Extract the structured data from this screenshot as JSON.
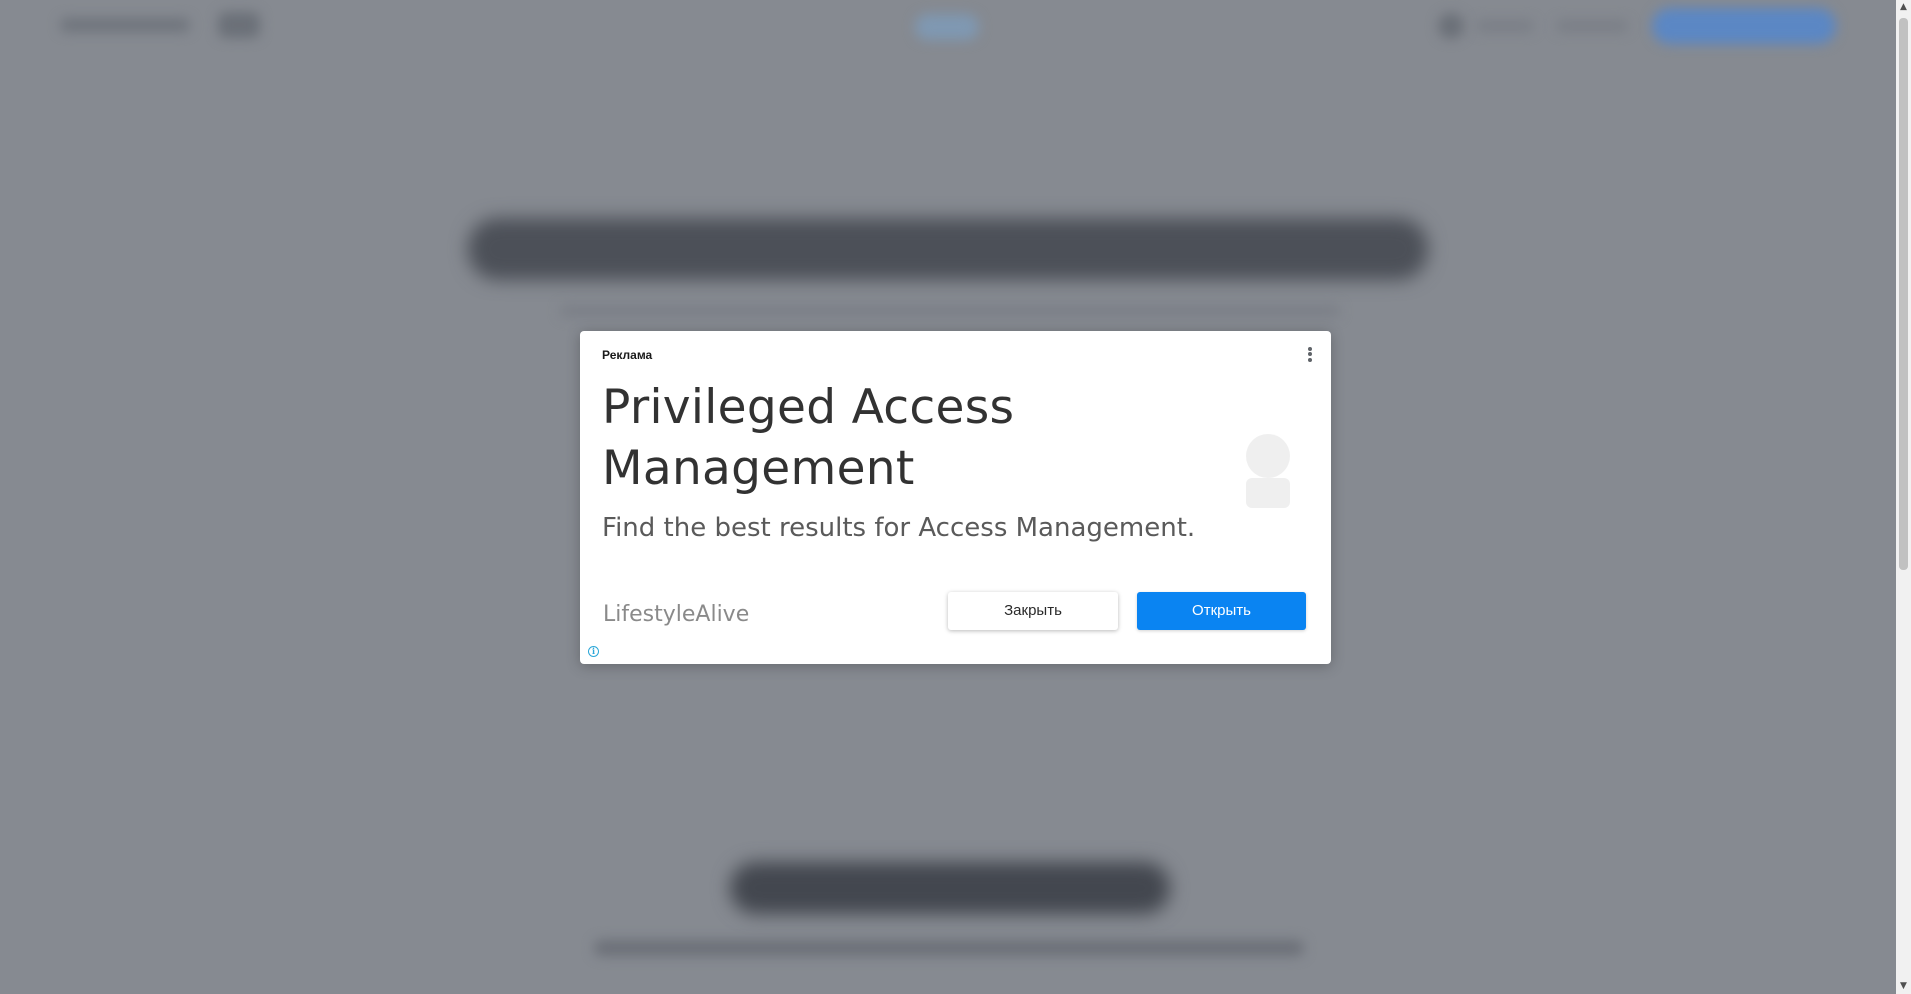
{
  "ad": {
    "label": "Реклама",
    "headline": "Privileged Access Management",
    "description": "Find the best results for Access Management.",
    "advertiser": "LifestyleAlive",
    "close_label": "Закрыть",
    "open_label": "Открыть",
    "info_glyph": "i",
    "menu_icon": "vertical-dots-icon",
    "colors": {
      "open_button": "#0a84f2",
      "info_icon": "#2ca7d8",
      "overlay": "#868a91"
    }
  },
  "scrollbar": {
    "up_glyph": "▲",
    "down_glyph": "▼"
  }
}
